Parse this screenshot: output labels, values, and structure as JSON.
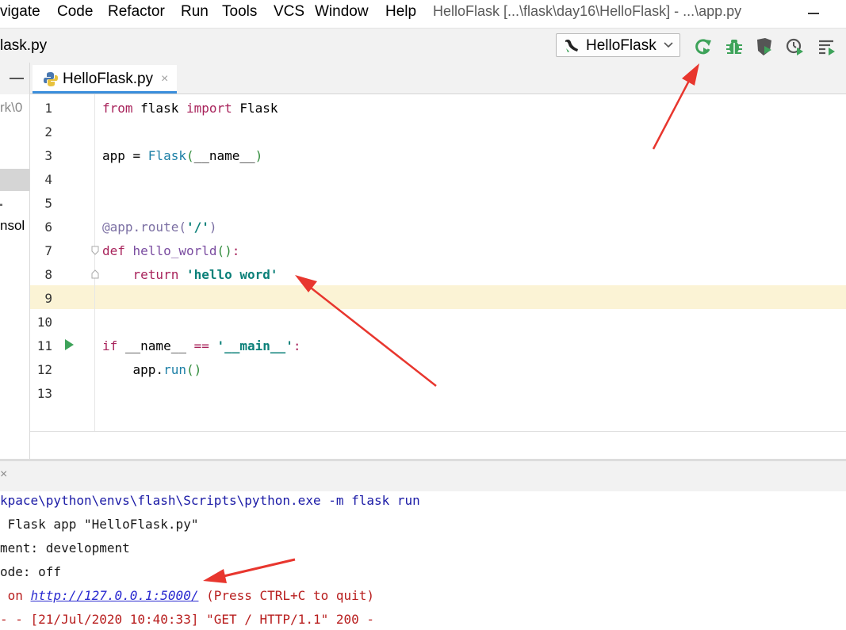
{
  "menu": {
    "items": [
      "vigate",
      "Code",
      "Refactor",
      "Run",
      "Tools",
      "VCS",
      "Window",
      "Help"
    ],
    "window_title": "HelloFlask [...\\flask\\day16\\HelloFlask] - ...\\app.py"
  },
  "navbar": {
    "breadcrumb": "lask.py",
    "run_config": "HelloFlask",
    "buttons": [
      "rerun-icon",
      "debug-icon",
      "coverage-icon",
      "profile-icon",
      "run-tasks-icon"
    ]
  },
  "project_panel": {
    "fragment_path": "rk\\0",
    "fragment_console": "nsol"
  },
  "tabs": [
    {
      "label": "HelloFlask.py",
      "close": "×"
    }
  ],
  "editor": {
    "line_numbers": [
      "1",
      "2",
      "3",
      "4",
      "5",
      "6",
      "7",
      "8",
      "9",
      "10",
      "11",
      "12",
      "13"
    ],
    "code": {
      "l1": {
        "kw1": "from",
        "mod": " flask ",
        "kw2": "import",
        "name": " Flask"
      },
      "l3": {
        "pre": "app = ",
        "call": "Flask",
        "open": "(",
        "arg": "__name__",
        "close": ")"
      },
      "l6": {
        "dec": "@app.route(",
        "str": "'/'",
        "close": ")"
      },
      "l7": {
        "kw": "def",
        "fn": " hello_world",
        "parens": "()",
        "colon": ":"
      },
      "l8": {
        "indent": "    ",
        "kw": "return",
        "str": " 'hello word'"
      },
      "l11": {
        "kw": "if",
        "name": " __name__ ",
        "op": "==",
        "str": " '__main__'",
        "colon": ":"
      },
      "l12": {
        "indent": "    app.",
        "call": "run",
        "parens": "()"
      }
    },
    "current_line": 9
  },
  "console": {
    "close": "×",
    "lines": [
      "kpace\\python\\envs\\flash\\Scripts\\python.exe -m flask run",
      " Flask app \"HelloFlask.py\"",
      "ment: development",
      "ode: off"
    ],
    "running_prefix": " on ",
    "url": "http://127.0.0.1:5000/",
    "running_suffix": " (Press CTRL+C to quit)",
    "request_log": "- - [21/Jul/2020 10:40:33] \"GET / HTTP/1.1\" 200 -"
  },
  "colors": {
    "accent_tab": "#3a8edc",
    "annotation_red": "#e8362e",
    "run_green": "#3ea35a",
    "current_line_bg": "#fbf3d5"
  }
}
